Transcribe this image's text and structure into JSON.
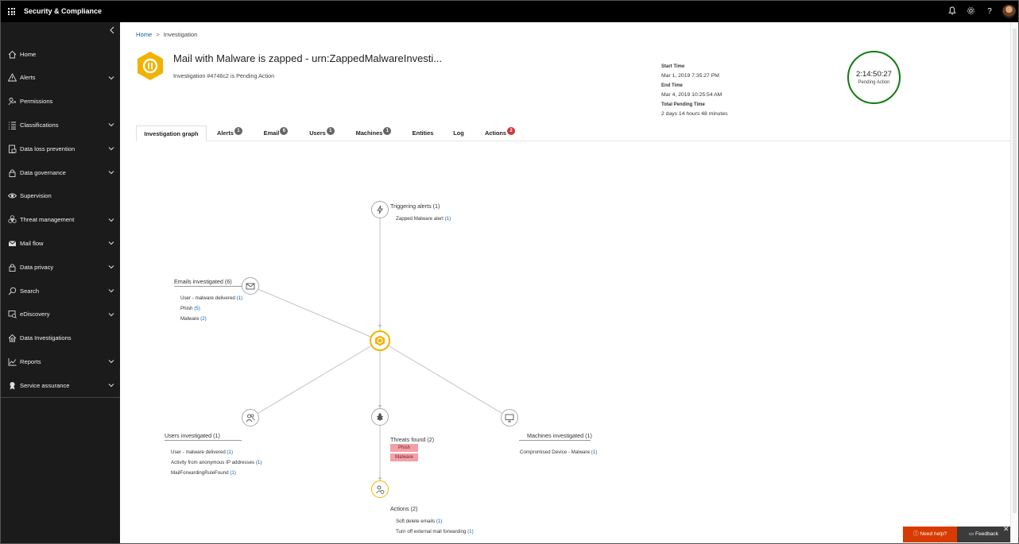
{
  "app": {
    "title": "Security & Compliance"
  },
  "topbar": {
    "icons": [
      "bell-icon",
      "gear-icon",
      "help-icon",
      "avatar"
    ],
    "help_glyph": "?"
  },
  "sidebar": {
    "items": [
      {
        "label": "Home",
        "icon": "home-icon",
        "expandable": false
      },
      {
        "label": "Alerts",
        "icon": "warning-icon",
        "expandable": true
      },
      {
        "label": "Permissions",
        "icon": "permissions-icon",
        "expandable": false
      },
      {
        "label": "Classifications",
        "icon": "list-icon",
        "expandable": true
      },
      {
        "label": "Data loss prevention",
        "icon": "dlp-icon",
        "expandable": true
      },
      {
        "label": "Data governance",
        "icon": "lock-icon",
        "expandable": true
      },
      {
        "label": "Supervision",
        "icon": "eye-icon",
        "expandable": false
      },
      {
        "label": "Threat management",
        "icon": "biohazard-icon",
        "expandable": true
      },
      {
        "label": "Mail flow",
        "icon": "mail-icon",
        "expandable": true
      },
      {
        "label": "Data privacy",
        "icon": "lock-icon",
        "expandable": true
      },
      {
        "label": "Search",
        "icon": "search-icon",
        "expandable": true
      },
      {
        "label": "eDiscovery",
        "icon": "ediscovery-icon",
        "expandable": true
      },
      {
        "label": "Data Investigations",
        "icon": "house-search-icon",
        "expandable": false
      },
      {
        "label": "Reports",
        "icon": "chart-icon",
        "expandable": true
      },
      {
        "label": "Service assurance",
        "icon": "ribbon-icon",
        "expandable": true
      }
    ]
  },
  "breadcrumb": {
    "home": "Home",
    "separator": ">",
    "current": "Investigation"
  },
  "investigation": {
    "title": "Mail with Malware is zapped - urn:ZappedMalwareInvesti...",
    "subtitle": "Investigation #4746c2 is Pending Action",
    "start_time_label": "Start Time",
    "start_time": "Mar 1, 2019 7:35:27 PM",
    "end_time_label": "End Time",
    "end_time": "Mar 4, 2019 10:25:54 AM",
    "total_pending_label": "Total Pending Time",
    "total_pending": "2 days 14 hours 48 minutes",
    "timer": "2:14:50:27",
    "timer_status": "Pending Action",
    "status_color": "#107c10",
    "accent_color": "#f2b200"
  },
  "tabs": [
    {
      "label": "Investigation graph",
      "badge": ""
    },
    {
      "label": "Alerts",
      "badge": "1"
    },
    {
      "label": "Email",
      "badge": "6"
    },
    {
      "label": "Users",
      "badge": "1"
    },
    {
      "label": "Machines",
      "badge": "1"
    },
    {
      "label": "Entities",
      "badge": ""
    },
    {
      "label": "Log",
      "badge": ""
    },
    {
      "label": "Actions",
      "badge": "2"
    }
  ],
  "graph": {
    "triggering": {
      "title": "Triggering alerts (1)",
      "items": [
        {
          "text": "Zapped Malware alert",
          "count": "(1)"
        }
      ]
    },
    "emails": {
      "title": "Emails investigated (6)",
      "items": [
        {
          "text": "User - malware delivered",
          "count": "(1)"
        },
        {
          "text": "Phish",
          "count": "(5)"
        },
        {
          "text": "Malware",
          "count": "(2)"
        }
      ]
    },
    "users": {
      "title": "Users investigated (1)",
      "items": [
        {
          "text": "User - malware delivered",
          "count": "(1)"
        },
        {
          "text": "Activity from anonymous IP addresses",
          "count": "(1)"
        },
        {
          "text": "MailForwardingRuleFound",
          "count": "(1)"
        }
      ]
    },
    "threats": {
      "title": "Threats found (2)",
      "tags": [
        "Phish",
        "Malware"
      ]
    },
    "machines": {
      "title": "Machines investigated (1)",
      "items": [
        {
          "text": "Compromised Device - Malware",
          "count": "(1)"
        }
      ]
    },
    "actions": {
      "title": "Actions (2)",
      "items": [
        {
          "text": "Soft delete emails",
          "count": "(1)"
        },
        {
          "text": "Turn off external mail forwarding",
          "count": "(1)"
        }
      ]
    }
  },
  "footer": {
    "help": "Need help?",
    "feedback": "Feedback",
    "close": "✕"
  }
}
